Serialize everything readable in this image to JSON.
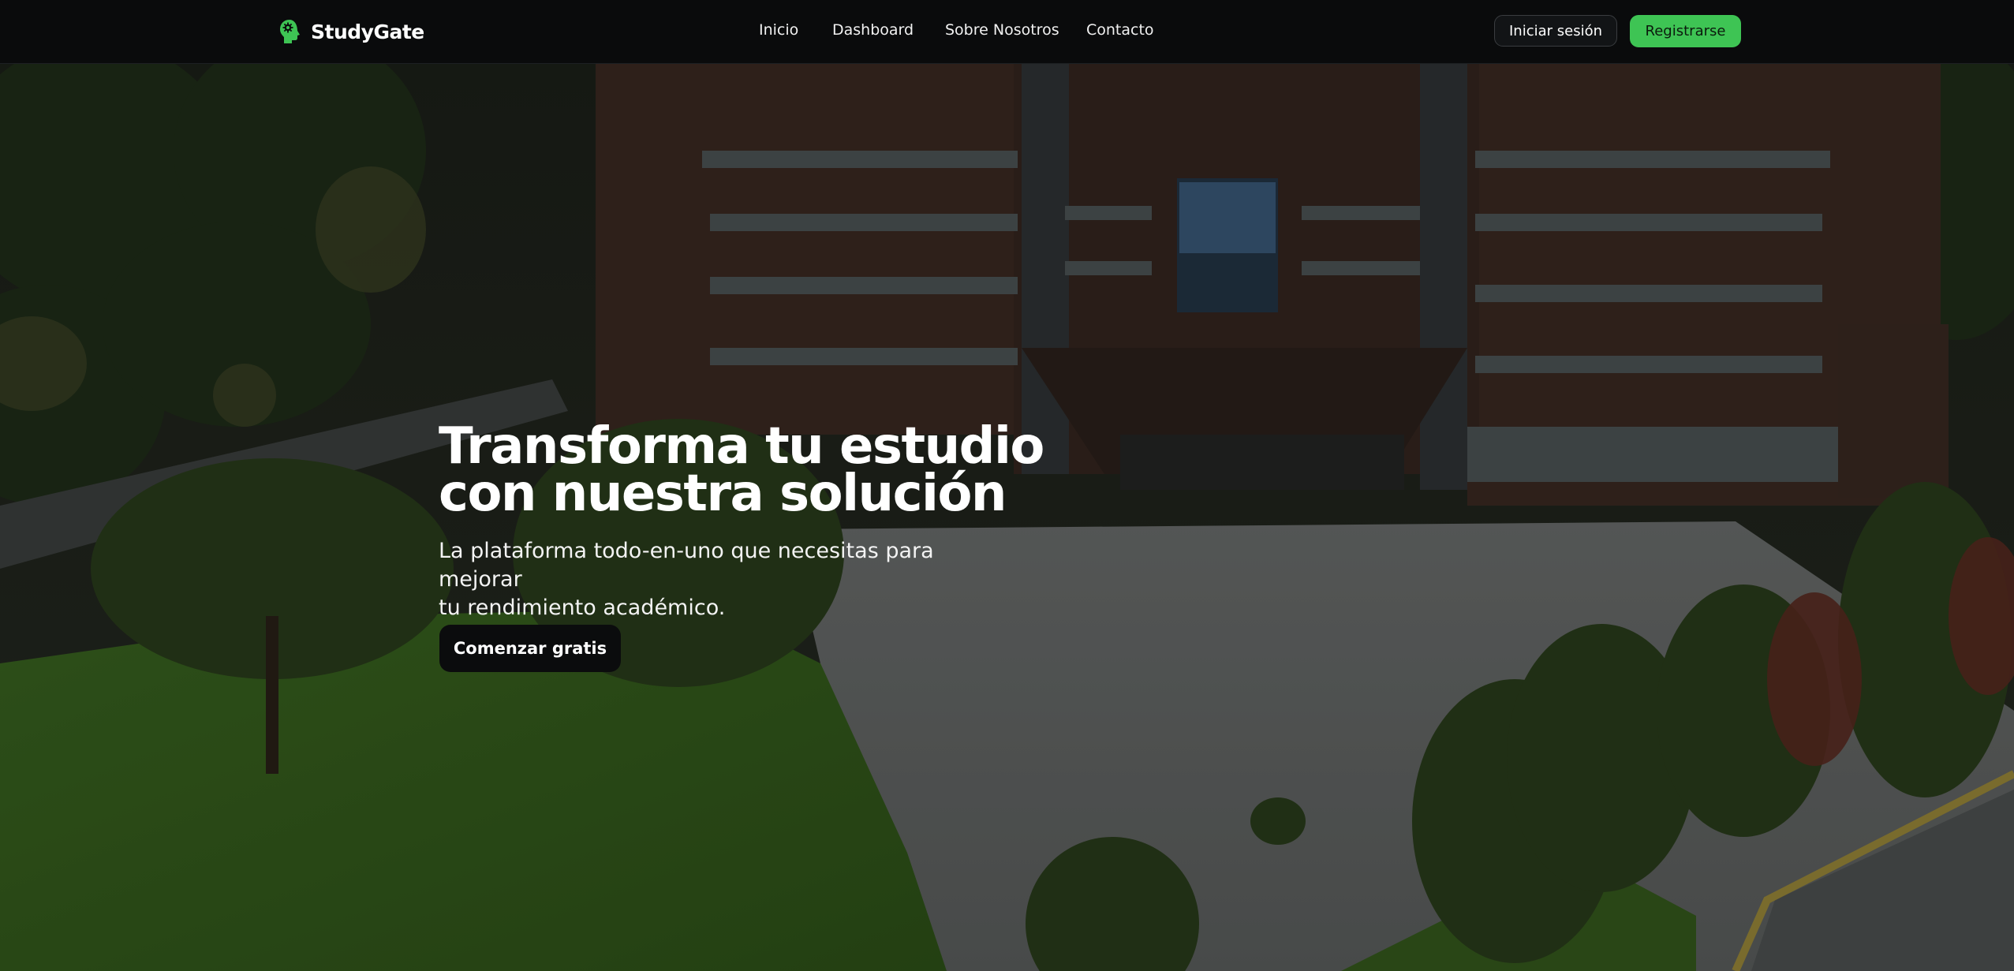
{
  "brand": {
    "name": "StudyGate",
    "logo_icon": "brain-head-icon",
    "accent_color": "#3ec454"
  },
  "nav": {
    "links": [
      {
        "label": "Inicio"
      },
      {
        "label": "Dashboard"
      },
      {
        "label": "Sobre Nosotros"
      },
      {
        "label": "Contacto"
      }
    ],
    "login_label": "Iniciar sesión",
    "register_label": "Registrarse"
  },
  "hero": {
    "title_lines": [
      "Transforma tu estudio",
      "con nuestra solución"
    ],
    "subtitle_lines": [
      "La plataforma todo-en-uno que necesitas para mejorar",
      "tu rendimiento académico."
    ],
    "cta_label": "Comenzar gratis"
  }
}
